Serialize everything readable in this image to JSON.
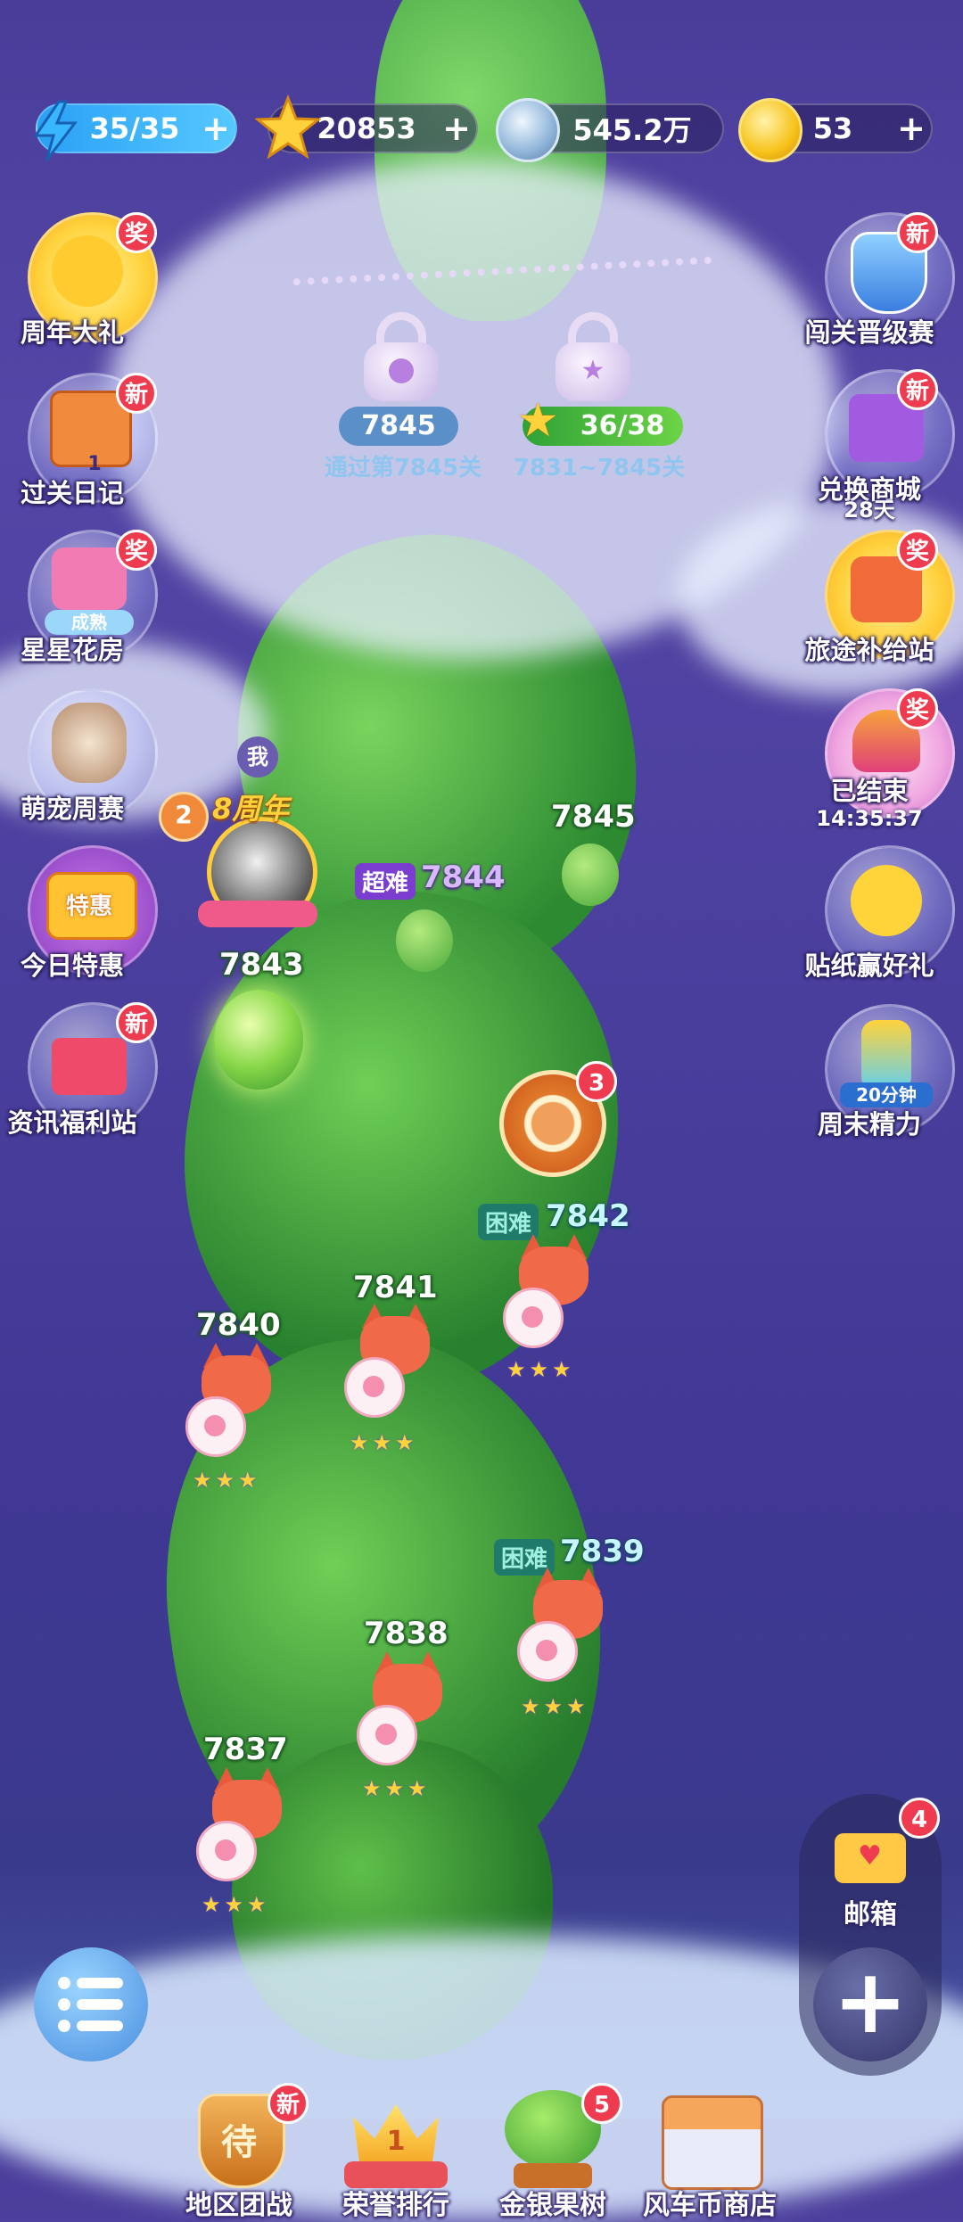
{
  "resources": {
    "energy": {
      "value": "35/35",
      "plus": "+"
    },
    "stars": {
      "value": "20853",
      "plus": "+"
    },
    "coins": {
      "value": "545.2万"
    },
    "gold": {
      "value": "53",
      "plus": "+"
    }
  },
  "locks": {
    "lock1": {
      "level": "7845",
      "caption": "通过第7845关"
    },
    "lock2": {
      "progress": "36/38",
      "caption": "7831~7845关"
    }
  },
  "left_buttons": [
    {
      "label": "周年大礼",
      "badge": "奖"
    },
    {
      "label": "过关日记",
      "badge": "新",
      "count": "1"
    },
    {
      "label": "星星花房",
      "badge": "奖",
      "tag": "成熟"
    },
    {
      "label": "萌宠周赛"
    },
    {
      "label": "今日特惠",
      "tag": "特惠"
    },
    {
      "label": "资讯福利站",
      "badge": "新"
    }
  ],
  "right_buttons": [
    {
      "label": "闯关晋级赛",
      "badge": "新"
    },
    {
      "label": "兑换商城",
      "badge": "新",
      "sub": "28天"
    },
    {
      "label": "旅途补给站",
      "badge": "奖"
    },
    {
      "label": "已结束",
      "badge": "奖",
      "sub": "14:35:37"
    },
    {
      "label": "贴纸赢好礼"
    },
    {
      "label": "周末精力",
      "tag": "20分钟"
    }
  ],
  "player": {
    "me_tag": "我",
    "rank": "2",
    "anniv": "8周年"
  },
  "levels": [
    {
      "num": "7845"
    },
    {
      "num": "7844",
      "difficulty": "超难"
    },
    {
      "num": "7843"
    },
    {
      "num": "7842",
      "difficulty": "困难"
    },
    {
      "num": "7841"
    },
    {
      "num": "7840"
    },
    {
      "num": "7839",
      "difficulty": "困难"
    },
    {
      "num": "7838"
    },
    {
      "num": "7837"
    }
  ],
  "wheel_badge": "3",
  "mail": {
    "label": "邮箱",
    "badge": "4"
  },
  "bottom_nav": [
    {
      "label": "地区团战",
      "badge": "新",
      "icon_text": "待"
    },
    {
      "label": "荣誉排行",
      "icon_text": "1"
    },
    {
      "label": "金银果树",
      "badge": "5"
    },
    {
      "label": "风车币商店"
    }
  ],
  "colors": {
    "badge": "#ef3b4f",
    "energy": "#3ab4ff",
    "star": "#ffd23c",
    "stalk": "#3fae3a"
  }
}
